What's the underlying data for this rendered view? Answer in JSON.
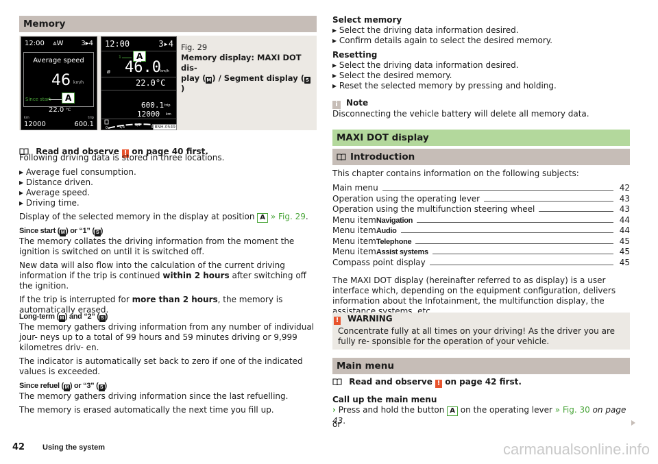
{
  "left": {
    "section_title": "Memory",
    "figure": {
      "maxidot": {
        "time": "12:00",
        "compass": "W",
        "gear": "3▸4",
        "title": "Average speed",
        "value": "46",
        "unit": "km/h",
        "memory_label": "Since start",
        "marker": "A",
        "temp": "22.0",
        "temp_unit": "°C",
        "km_label": "km",
        "trip_label": "trip",
        "odometer": "12000",
        "trip": "600.1"
      },
      "segment": {
        "time": "12:00",
        "gear": "3▸4",
        "memory_index": "1",
        "marker": "A",
        "avg_symbol": "ø",
        "value": "46.0",
        "unit": "km/h",
        "temp": "22.0°C",
        "trip": "600.1",
        "trip_label": "trip",
        "odometer": "12000",
        "odo_unit": "km",
        "fuel_ticks": [
          "0",
          "1/4",
          "1/2",
          "3/4",
          "1"
        ],
        "code": "BNH-0549"
      },
      "caption_num": "Fig. 29",
      "caption_title": "Memory display: MAXI DOT dis- play (M) / Segment display (S)"
    },
    "read_observe": {
      "pre": "Read and observe",
      "post": "on page 40 first."
    },
    "intro": "Following driving data is stored in three locations.",
    "bullets": [
      "Average fuel consumption.",
      "Distance driven.",
      "Average speed.",
      "Driving time."
    ],
    "position_text": {
      "pre": "Display of the selected memory in the display at position",
      "marker": "A",
      "link": "» Fig. 29",
      "post": "."
    },
    "since_start": {
      "heading": "Since start (M) or “1” (S)",
      "p1": "The memory collates the driving information from the moment the ignition is switched on until it is switched off.",
      "p2_pre": "New data will also flow into the calculation of the current driving information if the trip is continued",
      "p2_bold": "within 2 hours",
      "p2_post": "after switching off the ignition.",
      "p3_pre": "If the trip is interrupted for",
      "p3_bold": "more than 2 hours",
      "p3_post": ", the memory is automatically erased."
    },
    "long_term": {
      "heading": "Long-term (M) and “2” (S)",
      "p1": "The memory gathers driving information from any number of individual jour- neys up to a total of 99 hours and 59 minutes driving or 9,999 kilometres driv- en.",
      "p2": "The indicator is automatically set back to zero if one of the indicated values is exceeded."
    },
    "since_refuel": {
      "heading": "Since refuel (M) or “3” (S)",
      "p1": "The memory gathers driving information since the last refuelling.",
      "p2": "The memory is erased automatically the next time you fill up."
    }
  },
  "right": {
    "select_memory": {
      "heading": "Select memory",
      "bullets": [
        "Select the driving data information desired.",
        "Confirm details again to select the desired memory."
      ]
    },
    "resetting": {
      "heading": "Resetting",
      "bullets": [
        "Select the driving data information desired.",
        "Select the desired memory.",
        "Reset the selected memory by pressing and holding."
      ]
    },
    "note": {
      "title": "Note",
      "text": "Disconnecting the vehicle battery will delete all memory data."
    },
    "maxidot_title": "MAXI DOT display",
    "intro_title": "Introduction",
    "intro_text": "This chapter contains information on the following subjects:",
    "toc": [
      {
        "prefix": "Main menu",
        "bold": "",
        "page": "42"
      },
      {
        "prefix": "Operation using the operating lever",
        "bold": "",
        "page": "43"
      },
      {
        "prefix": "Operation using the multifunction steering wheel",
        "bold": "",
        "page": "43"
      },
      {
        "prefix": "Menu item",
        "bold": "Navigation",
        "page": "44"
      },
      {
        "prefix": "Menu item",
        "bold": "Audio",
        "page": "44"
      },
      {
        "prefix": "Menu item",
        "bold": "Telephone",
        "page": "45"
      },
      {
        "prefix": "Menu item",
        "bold": "Assist systems",
        "page": "45"
      },
      {
        "prefix": "Compass point display",
        "bold": "",
        "page": "45"
      }
    ],
    "description": "The MAXI DOT display (hereinafter referred to as display) is a user interface which, depending on the equipment configuration, delivers information about the Infotainment, the multifunction display, the assistance systems, etc.",
    "warning": {
      "title": "WARNING",
      "text": "Concentrate fully at all times on your driving! As the driver you are fully re- sponsible for the operation of your vehicle."
    },
    "main_menu_title": "Main menu",
    "read_observe": {
      "pre": "Read and observe",
      "post": "on page 42 first."
    },
    "call_up": {
      "heading": "Call up the main menu",
      "pre": "Press and hold the button",
      "marker": "A",
      "mid": "on the operating lever",
      "link": "» Fig. 30",
      "italic": "on page 43",
      "post": "."
    },
    "or": "or"
  },
  "footer": {
    "page_num": "42",
    "section": "Using the system",
    "watermark": "carmanualsonline.info"
  }
}
